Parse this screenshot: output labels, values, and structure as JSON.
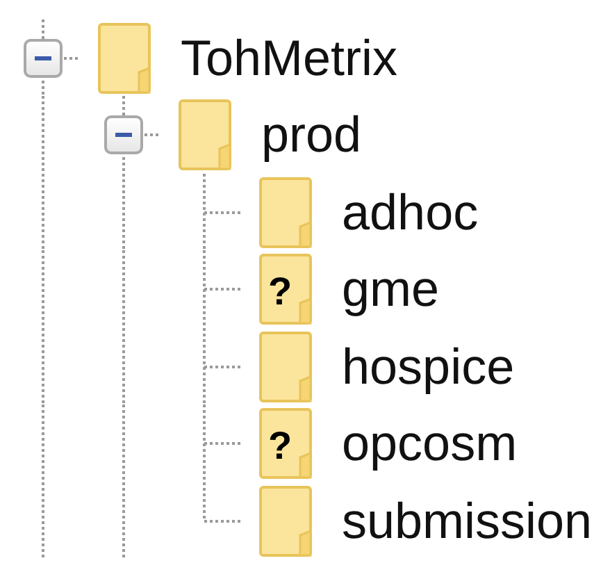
{
  "tree": [
    {
      "label": "TohMetrix",
      "expanded": true,
      "children": [
        {
          "label": "prod",
          "expanded": true,
          "children": [
            {
              "label": "adhoc"
            },
            {
              "label": "gme",
              "badge": "?"
            },
            {
              "label": "hospice"
            },
            {
              "label": "opcosm",
              "badge": "?"
            },
            {
              "label": "submission"
            }
          ]
        }
      ]
    }
  ]
}
